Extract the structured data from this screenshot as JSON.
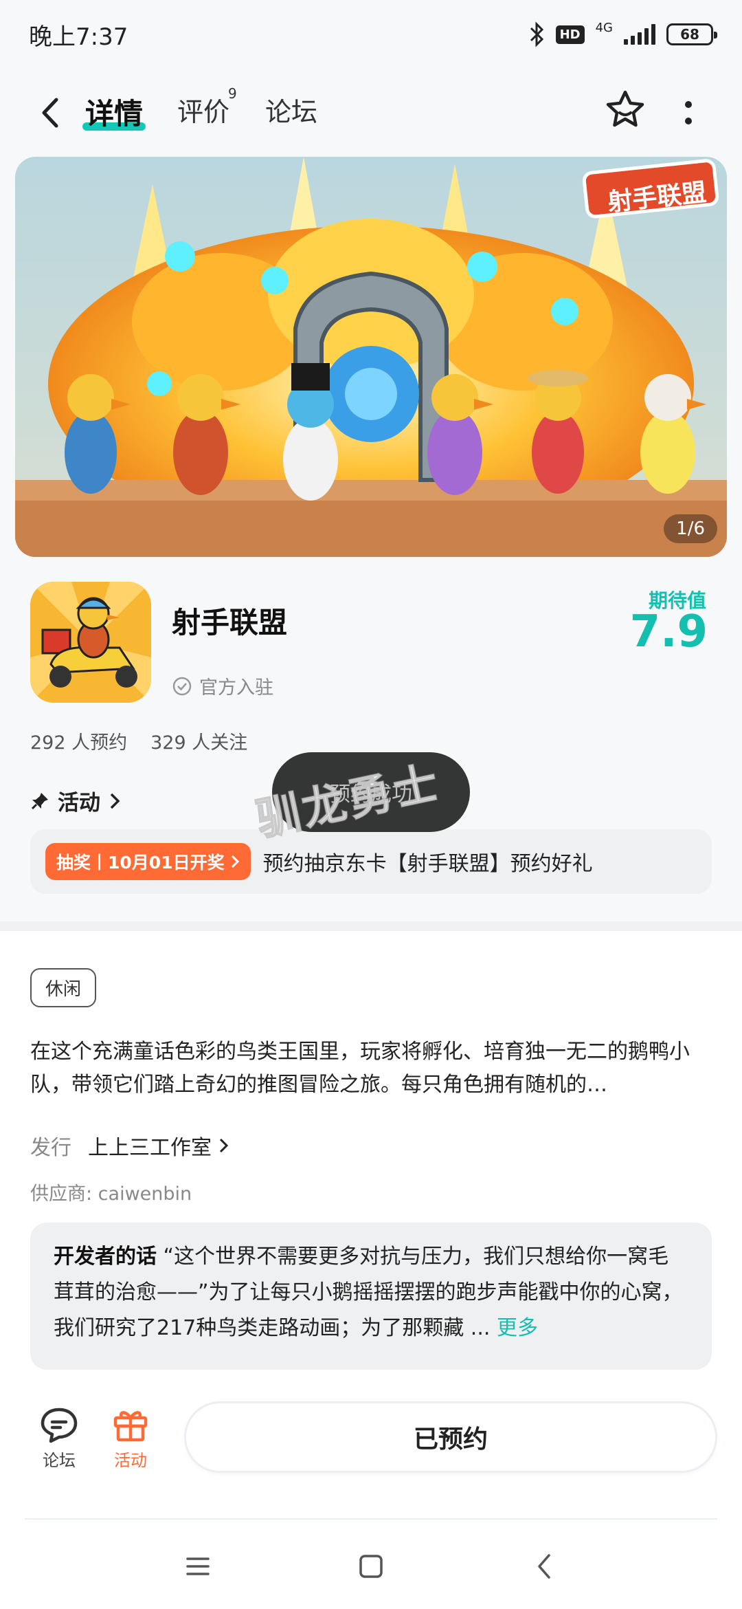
{
  "status_bar": {
    "time": "晚上7:37",
    "hd": "HD",
    "network": "4G",
    "battery": "68"
  },
  "nav": {
    "tabs": [
      {
        "label": "详情",
        "active": true
      },
      {
        "label": "评价",
        "count": "9"
      },
      {
        "label": "论坛"
      }
    ],
    "icons": [
      "back-icon",
      "favorite-star-icon",
      "more-icon"
    ]
  },
  "banner": {
    "logo_text": "射手联盟",
    "counter": "1/6"
  },
  "app": {
    "name": "射手联盟",
    "official": "官方入驻",
    "expect_label": "期待值",
    "expect_value": "7.9",
    "reservations": "292 人预约",
    "followers": "329 人关注"
  },
  "activity": {
    "title": "活动",
    "lottery_tag": "抽奖丨10月01日开奖",
    "lottery_text": "预约抽京东卡【射手联盟】预约好礼"
  },
  "overlay": {
    "toast": "预约成功",
    "watermark": "驯龙勇士"
  },
  "details": {
    "genre": "休闲",
    "description": "在这个充满童话色彩的鸟类王国里，玩家将孵化、培育独一无二的鹅鸭小队，带领它们踏上奇幻的推图冒险之旅。每只角色拥有随机的…",
    "publisher_label": "发行",
    "publisher_value": "上上三工作室",
    "supplier": "供应商: caiwenbin"
  },
  "developer": {
    "title": "开发者的话",
    "text": " “这个世界不需要更多对抗与压力，我们只想给你一窝毛茸茸的治愈——”为了让每只小鹅摇摇摆摆的跑步声能戳中你的心窝，我们研究了217种鸟类走路动画；为了那颗藏 ... ",
    "more": "更多"
  },
  "bottom_bar": {
    "forum": "论坛",
    "activity": "活动",
    "reserved": "已预约",
    "activity_color": "#ff6a35"
  },
  "colors": {
    "accent": "#14bfb0",
    "orange": "#ff6a35"
  }
}
